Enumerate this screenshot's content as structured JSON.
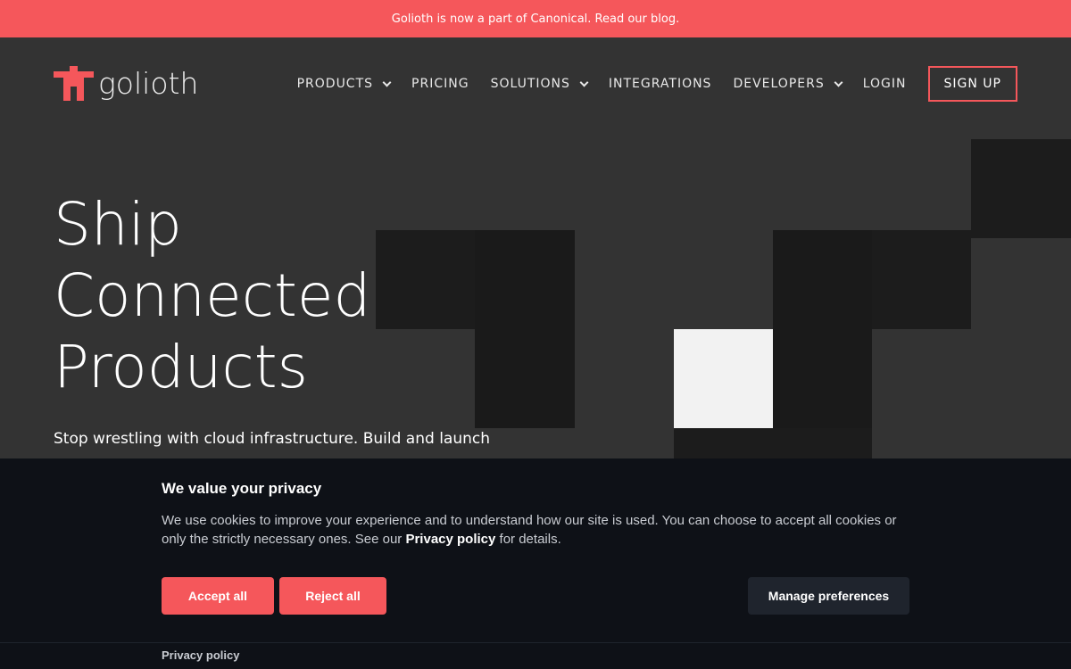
{
  "announcement": "Golioth is now a part of Canonical. Read our blog.",
  "logo": {
    "text": "golioth",
    "icon": "golioth-logo-icon",
    "color": "#f5575b"
  },
  "nav": {
    "items": [
      {
        "label": "PRODUCTS",
        "dropdown": true
      },
      {
        "label": "PRICING",
        "dropdown": false
      },
      {
        "label": "SOLUTIONS",
        "dropdown": true
      },
      {
        "label": "INTEGRATIONS",
        "dropdown": false
      },
      {
        "label": "DEVELOPERS",
        "dropdown": true
      },
      {
        "label": "LOGIN",
        "dropdown": false
      }
    ],
    "signup": "SIGN UP"
  },
  "hero": {
    "title_lines": [
      "Ship",
      "Connected",
      "Products"
    ],
    "subtitle": "Stop wrestling with cloud infrastructure. Build and launch"
  },
  "cookie": {
    "title": "We value your privacy",
    "text_before": "We use cookies to improve your experience and to understand how our site is used. You can choose to accept all cookies or only the strictly necessary ones. See our ",
    "text_link": "Privacy policy",
    "text_after": " for details.",
    "accept": "Accept all",
    "reject": "Reject all",
    "manage": "Manage preferences",
    "footer_link": "Privacy policy"
  },
  "colors": {
    "accent": "#f5575b",
    "background": "#333333",
    "banner_bg": "#0e1117"
  }
}
